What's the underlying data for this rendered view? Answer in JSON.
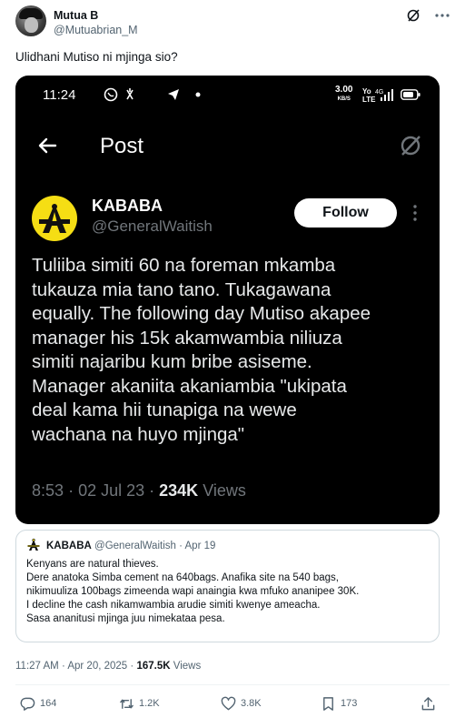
{
  "author": {
    "name": "Mutua B",
    "handle": "@Mutuabrian_M"
  },
  "tweet_text": "Ulidhani Mutiso ni mjinga sio?",
  "embedded": {
    "status_time": "11:24",
    "status_speed": "3.00",
    "status_speed_unit": "KB/S",
    "status_net": "4G",
    "header_title": "Post",
    "account_name": "KABABA",
    "account_handle": "@GeneralWaitish",
    "follow_label": "Follow",
    "text_lines": [
      "Tuliiba simiti 60 na foreman mkamba",
      "tukauza mia tano tano. Tukagawana",
      "equally. The following day Mutiso akapee",
      "manager his 15k akamwambia niliuza",
      "simiti najaribu kum bribe asiseme.",
      "Manager akaniita akaniambia \"ukipata",
      "deal kama hii tunapiga na wewe",
      "wachana na huyo mjinga\""
    ],
    "time": "8:53",
    "date": "02 Jul 23",
    "views_count": "234K",
    "views_label": "Views"
  },
  "quote": {
    "name": "KABABA",
    "handle": "@GeneralWaitish",
    "date": "Apr 19",
    "lines": [
      "Kenyans are natural thieves.",
      "Dere anatoka Simba cement na 640bags. Anafika site na 540 bags,",
      "nikimuuliza 100bags zimeenda wapi anaingia kwa mfuko ananipee 30K.",
      "I decline the cash nikamwambia arudie simiti kwenye ameacha.",
      "Sasa ananitusi mjinga juu nimekataa pesa."
    ]
  },
  "timestamp": {
    "time": "11:27 AM",
    "date": "Apr 20, 2025",
    "views_count": "167.5K",
    "views_label": "Views"
  },
  "actions": {
    "replies": "164",
    "reposts": "1.2K",
    "likes": "3.8K",
    "bookmarks": "173"
  },
  "colors": {
    "text": "#0f1419",
    "secondary": "#536471",
    "shot_bg": "#000000",
    "logo_yellow": "#f5de14"
  }
}
